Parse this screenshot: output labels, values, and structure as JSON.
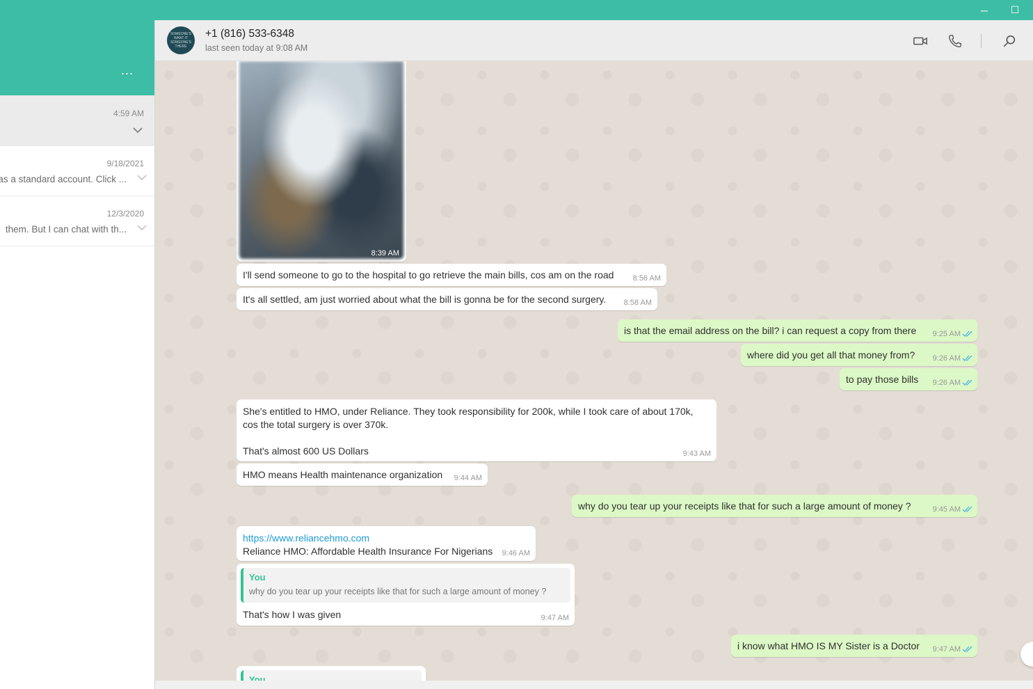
{
  "window": {
    "minimize": "─",
    "maximize": "☐"
  },
  "sidebar": {
    "menu_label": "...",
    "chats": [
      {
        "time": "4:59 AM",
        "snippet": ""
      },
      {
        "time": "9/18/2021",
        "snippet": "as a standard account. Click ..."
      },
      {
        "time": "12/3/2020",
        "snippet": "them. But I can chat with th..."
      }
    ]
  },
  "header": {
    "avatar_text": "SOMEONE'S WANT IT SOMEONE'S THERE",
    "name": "+1 (816) 533-6348",
    "status": "last seen today at 9:08 AM"
  },
  "messages": [
    {
      "dir": "in",
      "type": "image",
      "time": "8:39 AM"
    },
    {
      "dir": "in",
      "text": "I'll send someone to go to the hospital to go retrieve the main bills, cos am on the road",
      "time": "8:56 AM"
    },
    {
      "dir": "in",
      "text": "It's all settled, am just worried about what the bill is gonna be for the second surgery.",
      "time": "8:58 AM"
    },
    {
      "dir": "out",
      "text": "is that the email address on the bill? i can request a copy from there",
      "time": "9:25 AM"
    },
    {
      "dir": "out",
      "text": "where did you get all that money from?",
      "time": "9:26 AM"
    },
    {
      "dir": "out",
      "text": "to pay those bills",
      "time": "9:26 AM"
    },
    {
      "dir": "in",
      "lines": [
        "She's entitled to HMO, under Reliance. They took responsibility for 200k, while I took care of about 170k,",
        "cos the total surgery is over 370k.",
        "",
        "That's almost 600 US Dollars"
      ],
      "time": "9:43 AM"
    },
    {
      "dir": "in",
      "text": "HMO means Health maintenance organization",
      "time": "9:44 AM"
    },
    {
      "dir": "out",
      "text": "why do you tear up your receipts like that for such a large  amount of money ?",
      "time": "9:45 AM"
    },
    {
      "dir": "in",
      "link": "https://www.reliancehmo.com",
      "text": "Reliance HMO: Affordable Health Insurance For Nigerians",
      "time": "9:46 AM"
    },
    {
      "dir": "in",
      "quote_name": "You",
      "quote_text": "why do you tear up your receipts like that for such a large  amount of money ?",
      "text": "That's how I was given",
      "time": "9:47 AM"
    },
    {
      "dir": "out",
      "text": "i know what HMO IS MY Sister is a Doctor",
      "time": "9:47 AM"
    },
    {
      "dir": "in",
      "quote_name": "You"
    }
  ],
  "colors": {
    "accent": "#3dbda5",
    "outgoing": "#dcf8c6",
    "tick": "#4fb6ec"
  }
}
